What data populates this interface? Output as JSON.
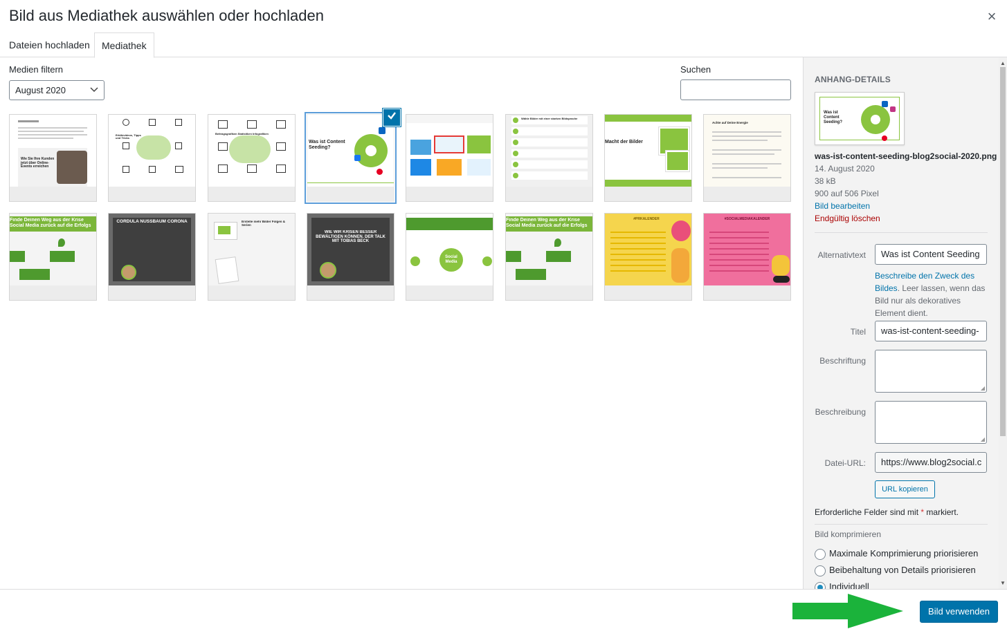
{
  "header": {
    "title": "Bild aus Mediathek auswählen oder hochladen",
    "close_icon": "×"
  },
  "tabs": [
    {
      "label": "Dateien hochladen",
      "active": false
    },
    {
      "label": "Mediathek",
      "active": true
    }
  ],
  "toolbar": {
    "filter_label": "Medien filtern",
    "filter_value": "August 2020",
    "search_label": "Suchen",
    "search_value": ""
  },
  "grid": {
    "row1": [
      {
        "caption": "Wie Sie Ihre Kunden jetzt über Online-Events erreichen"
      },
      {
        "caption": "Erklärvideos, Tipps und Tricks"
      },
      {
        "caption": "Beitragsgrafiken Statistiken Infografiken"
      },
      {
        "caption": "Was ist Content Seeding?",
        "selected": true
      },
      {
        "caption": ""
      },
      {
        "caption": "Wähle Bilder mit einer starken Bildsprache"
      },
      {
        "caption": "Macht der Bilder"
      },
      {
        "caption": "Achte auf Deine Energie"
      }
    ],
    "row2": [
      {
        "caption": "Finde Deinen Weg aus der Krise Social Media zurück auf die Erfolgs"
      },
      {
        "caption": "CORDULA NUSSBAUM CORONA"
      },
      {
        "caption": "Erstelle mehr Bilder Folgen & Serien"
      },
      {
        "caption": "WIE WIR KRISEN BESSER BEWÄLTIGEN KÖNNEN. DER TALK MIT TOBIAS BECK"
      },
      {
        "caption": "Social Media"
      },
      {
        "caption": "Finde Deinen Weg aus der Krise Social Media zurück auf die Erfolgs"
      },
      {
        "caption": "#PRKALENDER"
      },
      {
        "caption": "#SOCIALMEDIAKALENDER"
      }
    ]
  },
  "sidebar": {
    "heading": "ANHANG-DETAILS",
    "filename": "was-ist-content-seeding-blog2social-2020.png",
    "date": "14. August 2020",
    "filesize": "38 kB",
    "dimensions": "900 auf 506 Pixel",
    "edit_link": "Bild bearbeiten",
    "delete_link": "Endgültig löschen",
    "alt_label": "Alternativtext",
    "alt_value": "Was ist Content Seeding",
    "alt_help_link": "Beschreibe den Zweck des Bildes",
    "alt_help_rest": ". Leer lassen, wenn das Bild nur als dekoratives Element dient.",
    "title_label": "Titel",
    "title_value": "was-ist-content-seeding-",
    "caption_label": "Beschriftung",
    "description_label": "Beschreibung",
    "url_label": "Datei-URL:",
    "url_value": "https://www.blog2social.c",
    "copy_button": "URL kopieren",
    "required_note": "Erforderliche Felder sind mit ",
    "required_star": "*",
    "required_tail": " markiert.",
    "compress_title": "Bild komprimieren",
    "radio": [
      {
        "label": "Maximale Komprimierung priorisieren",
        "checked": false
      },
      {
        "label": "Beibehaltung von Details priorisieren",
        "checked": false
      },
      {
        "label": "Individuell",
        "checked": true
      }
    ]
  },
  "footer": {
    "use_button": "Bild verwenden"
  },
  "colors": {
    "primary": "#0073aa",
    "arrow": "#1bb33b",
    "danger": "#aa0000",
    "brand_green": "#8ac43f"
  }
}
